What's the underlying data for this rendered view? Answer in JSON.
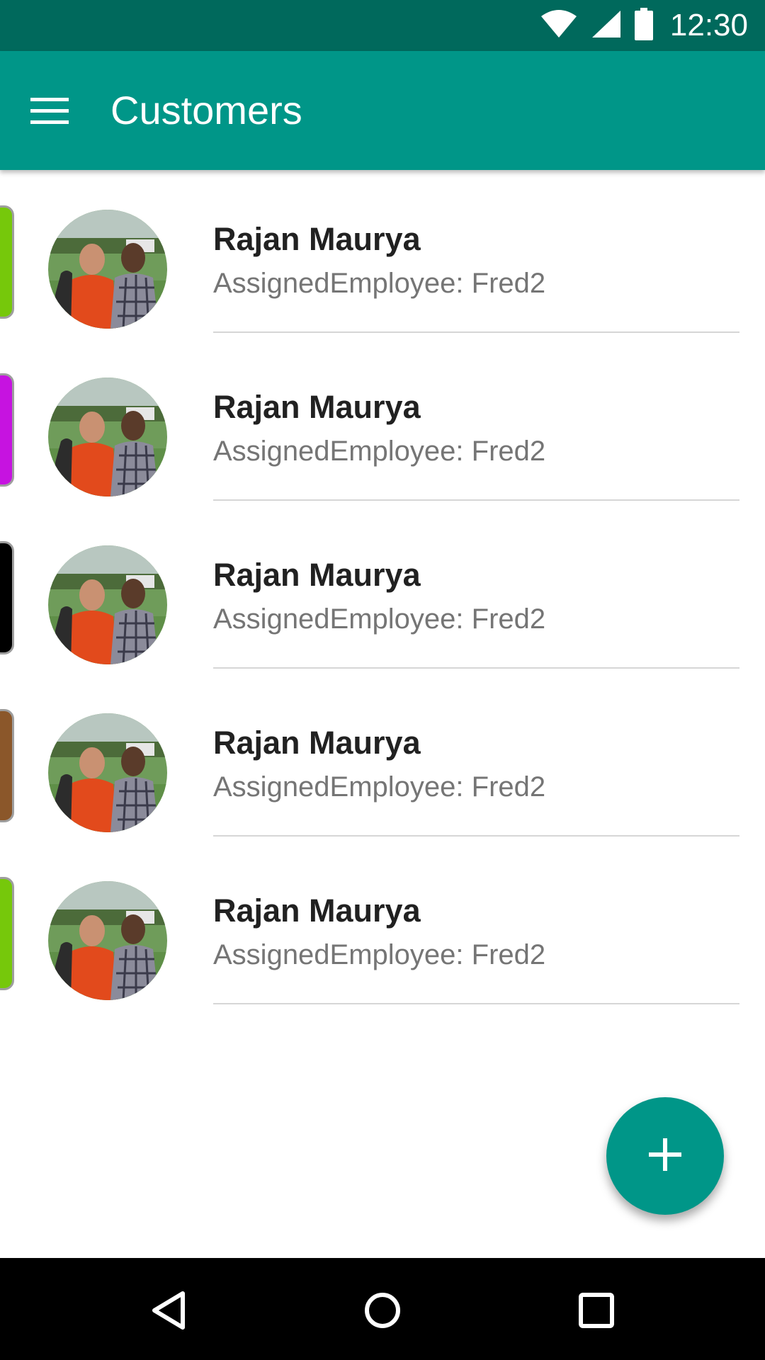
{
  "status_bar": {
    "time": "12:30",
    "icons": [
      "wifi-icon",
      "signal-icon",
      "battery-icon"
    ]
  },
  "app_bar": {
    "title": "Customers",
    "menu_icon": "hamburger-menu-icon",
    "background": "#009688"
  },
  "customers": [
    {
      "name": "Rajan Maurya",
      "subtitle": "AssignedEmployee: Fred2",
      "accent": "#76c80b"
    },
    {
      "name": "Rajan Maurya",
      "subtitle": "AssignedEmployee: Fred2",
      "accent": "#c613e0"
    },
    {
      "name": "Rajan Maurya",
      "subtitle": "AssignedEmployee: Fred2",
      "accent": "#000000"
    },
    {
      "name": "Rajan Maurya",
      "subtitle": "AssignedEmployee: Fred2",
      "accent": "#8b572a"
    },
    {
      "name": "Rajan Maurya",
      "subtitle": "AssignedEmployee: Fred2",
      "accent": "#76c80b"
    }
  ],
  "fab": {
    "icon": "add-icon",
    "color": "#009688"
  },
  "nav_bar": {
    "buttons": [
      "back-icon",
      "home-icon",
      "recents-icon"
    ]
  },
  "colors": {
    "status_bar": "#00695c",
    "primary": "#009688",
    "nav_bar": "#000000"
  }
}
